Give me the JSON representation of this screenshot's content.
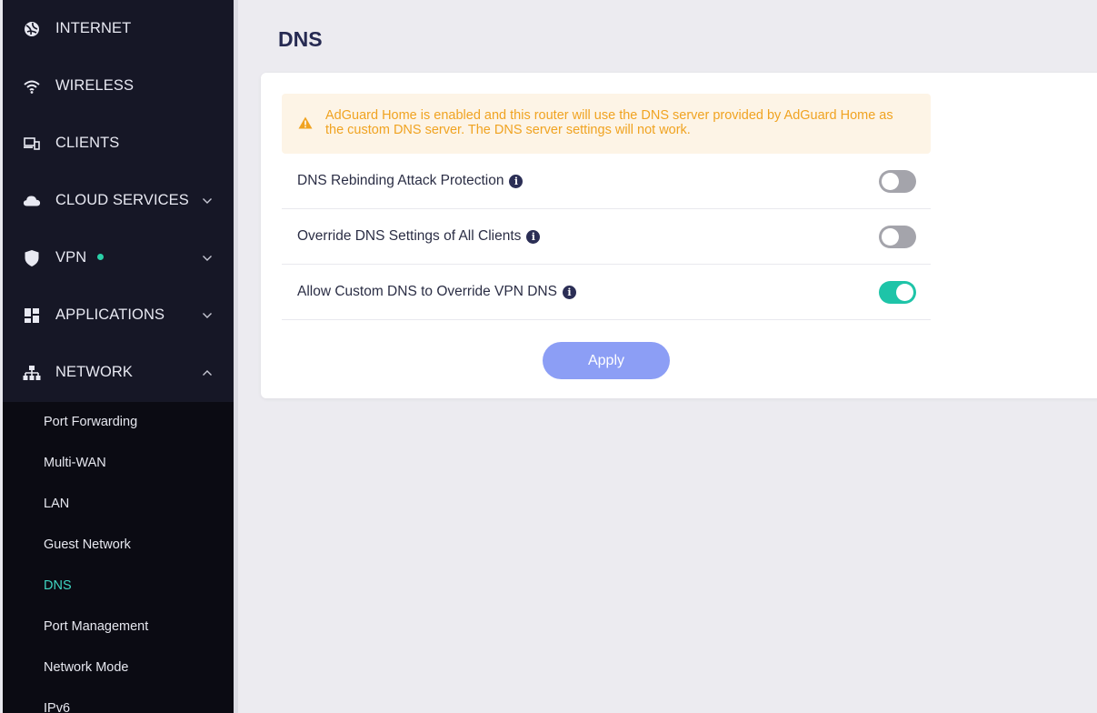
{
  "sidebar": {
    "items": [
      {
        "label": "INTERNET",
        "icon": "globe-icon"
      },
      {
        "label": "WIRELESS",
        "icon": "wifi-icon"
      },
      {
        "label": "CLIENTS",
        "icon": "devices-icon"
      },
      {
        "label": "CLOUD SERVICES",
        "icon": "cloud-icon",
        "chevron": "down"
      },
      {
        "label": "VPN",
        "icon": "shield-icon",
        "chevron": "down",
        "status_color": "#2ad0a8"
      },
      {
        "label": "APPLICATIONS",
        "icon": "apps-icon",
        "chevron": "down"
      },
      {
        "label": "NETWORK",
        "icon": "network-icon",
        "chevron": "up"
      }
    ],
    "submenu": [
      {
        "label": "Port Forwarding"
      },
      {
        "label": "Multi-WAN"
      },
      {
        "label": "LAN"
      },
      {
        "label": "Guest Network"
      },
      {
        "label": "DNS",
        "active": true
      },
      {
        "label": "Port Management"
      },
      {
        "label": "Network Mode"
      },
      {
        "label": "IPv6"
      }
    ],
    "active_color": "#3fd6c2"
  },
  "page": {
    "title": "DNS"
  },
  "card": {
    "warning": {
      "icon": "warning-icon",
      "text": "AdGuard Home is enabled and this router will use the DNS server provided by AdGuard Home as the custom DNS server. The DNS server settings will not work."
    },
    "settings": [
      {
        "label": "DNS Rebinding Attack Protection",
        "enabled": false
      },
      {
        "label": "Override DNS Settings of All Clients",
        "enabled": false
      },
      {
        "label": "Allow Custom DNS to Override VPN DNS",
        "enabled": true
      }
    ],
    "apply_label": "Apply"
  },
  "colors": {
    "sidebar_bg": "#161726",
    "submenu_bg": "#0b0b13",
    "accent_toggle": "#1ec4a8",
    "apply_button": "#8c9ef5",
    "warning_text": "#f0a321",
    "warning_bg": "#fdf4e6"
  }
}
